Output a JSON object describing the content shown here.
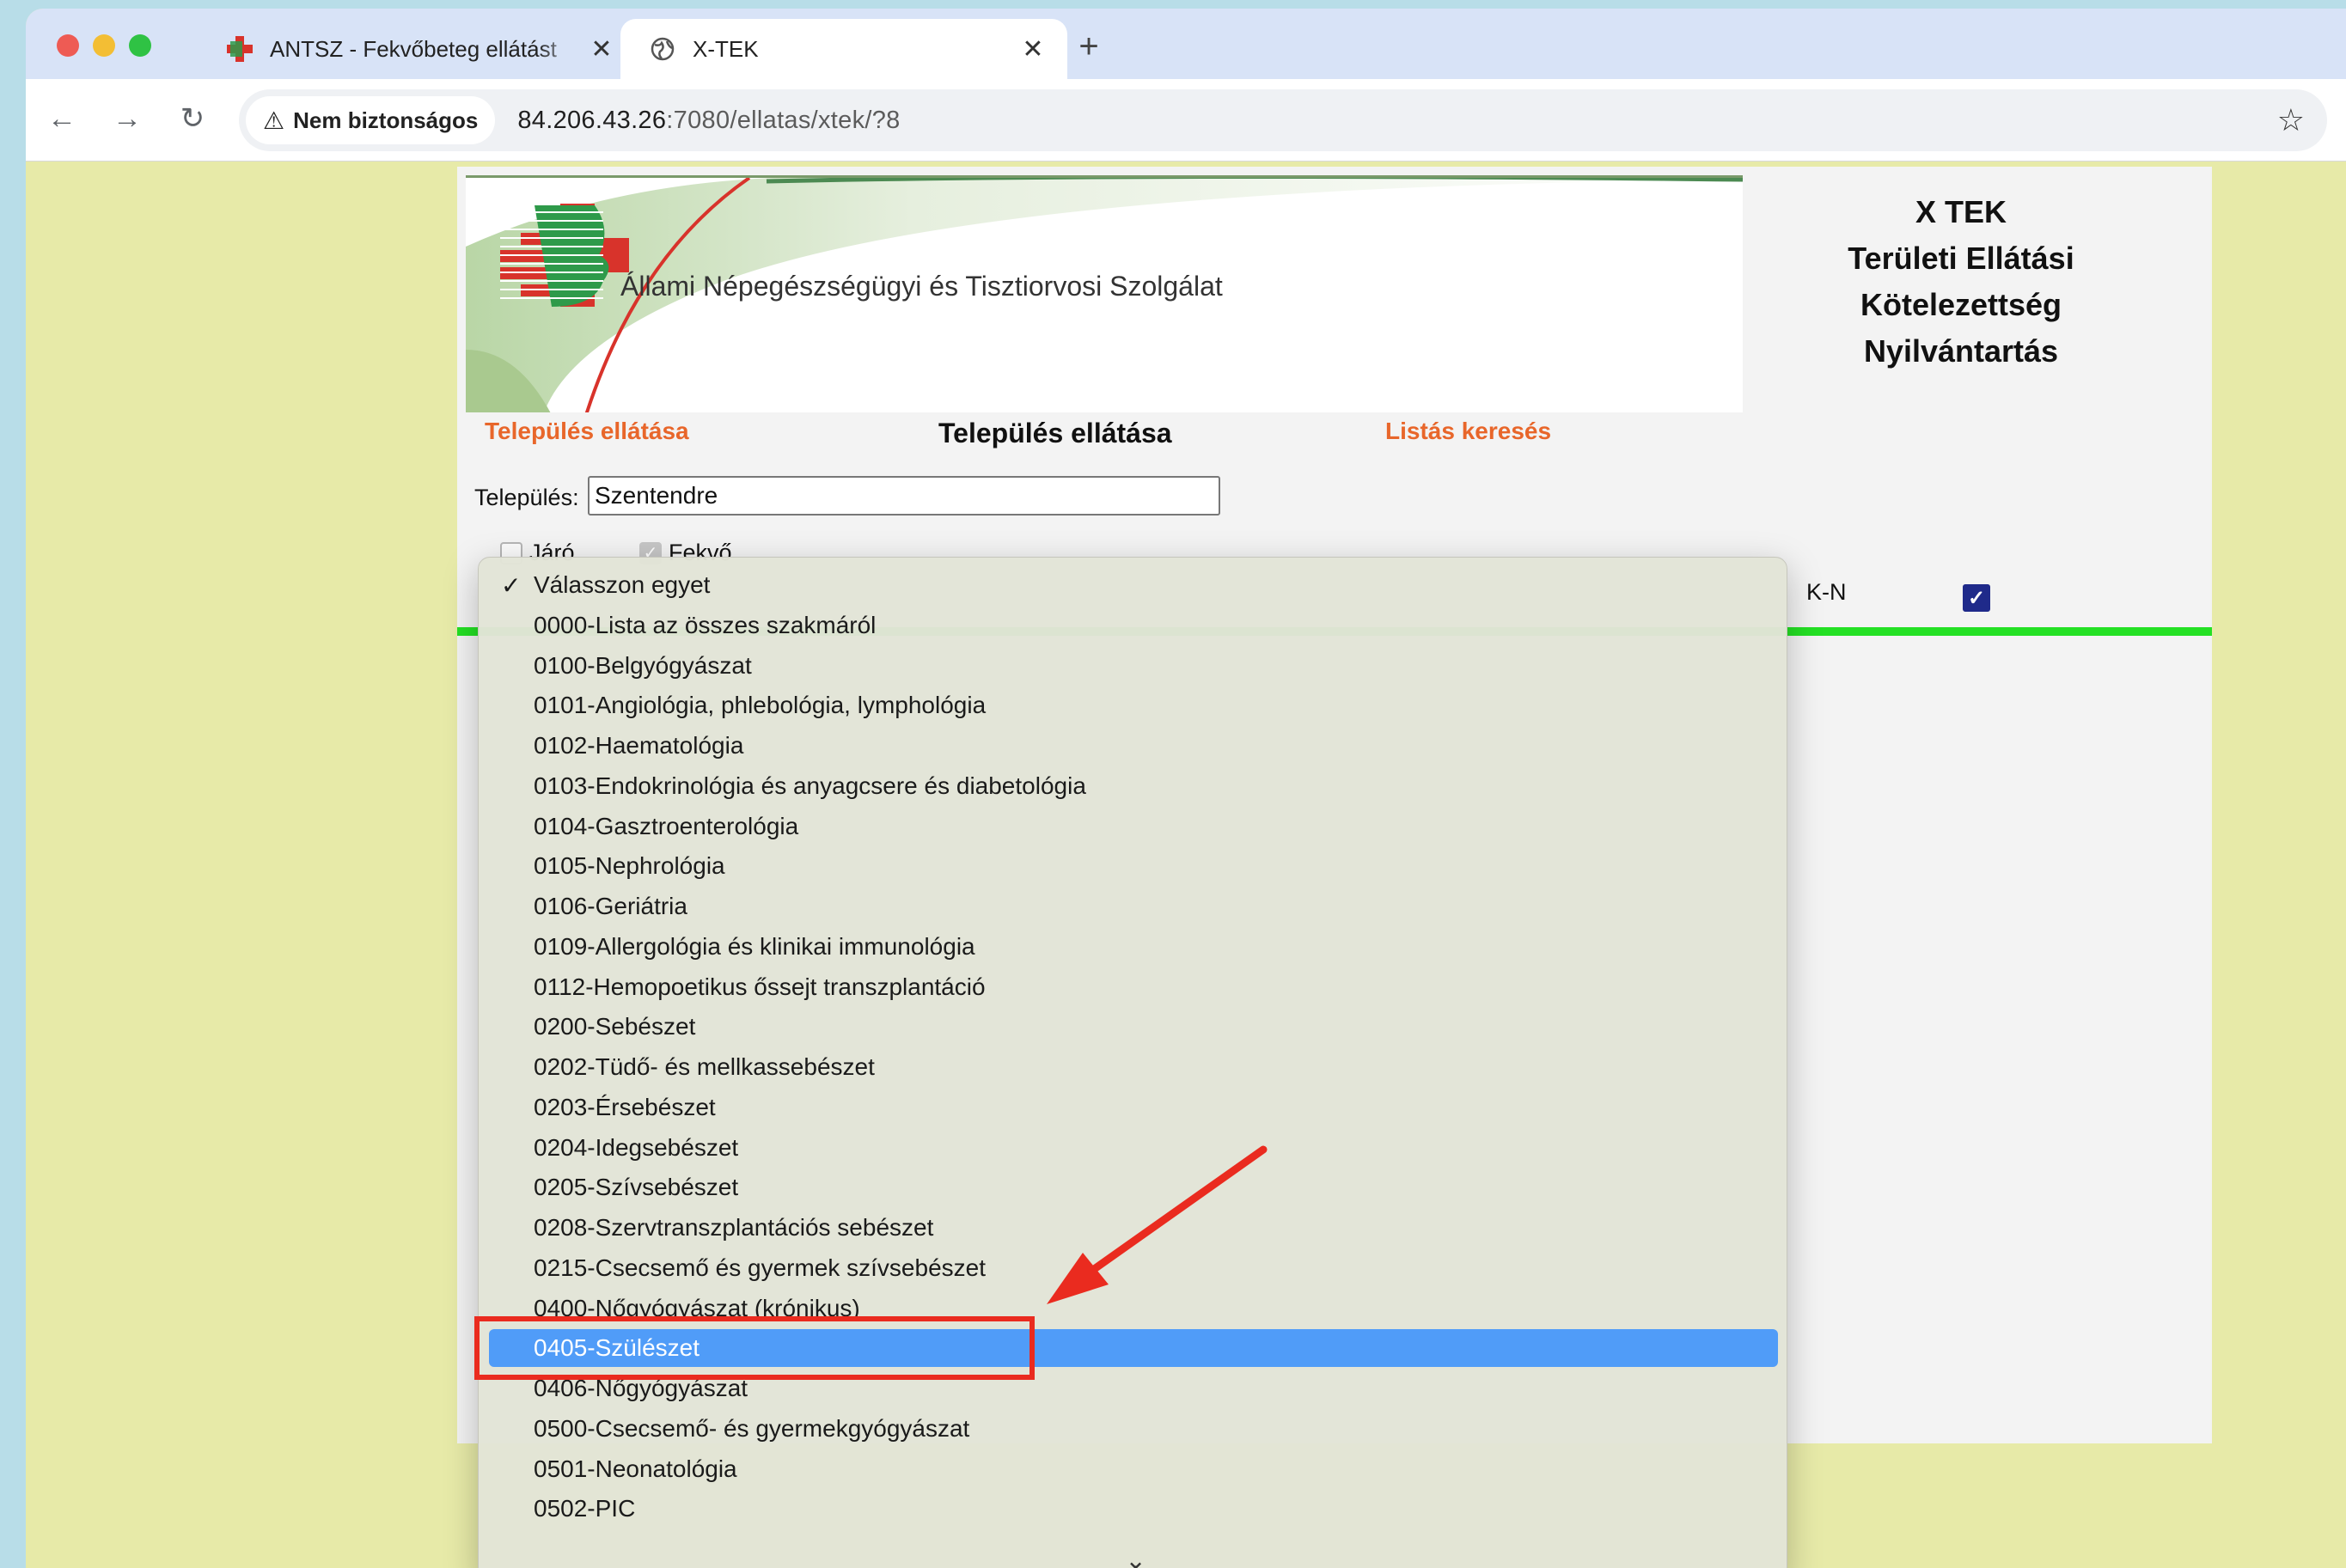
{
  "browser": {
    "tabs": [
      {
        "title": "ANTSZ - Fekvőbeteg ellátást",
        "icon": "antsz-cross-icon",
        "active": false
      },
      {
        "title": "X-TEK",
        "icon": "globe-icon",
        "active": true
      }
    ],
    "security_label": "Nem biztonságos",
    "url_host": "84.206.43.26",
    "url_path": ":7080/ellatas/xtek/?8"
  },
  "page": {
    "banner_title": "Állami Népegészségügyi és Tisztiorvosi Szolgálat",
    "side_title": [
      "X TEK",
      "Területi Ellátási",
      "Kötelezettség",
      "Nyilvántartás"
    ],
    "link_left": "Település ellátása",
    "center_heading": "Település ellátása",
    "link_right": "Listás keresés",
    "settlement_label": "Település:",
    "settlement_value": "Szentendre",
    "checkbox_jaro": {
      "label": "Járó",
      "checked": false
    },
    "checkbox_fekvo": {
      "label": "Fekvő",
      "checked": true
    },
    "kn_label": "K-N",
    "kn_checked": true
  },
  "dropdown": {
    "selected_index": 19,
    "options": [
      "Válasszon egyet",
      "0000-Lista az összes szakmáról",
      "0100-Belgyógyászat",
      "0101-Angiológia, phlebológia, lymphológia",
      "0102-Haematológia",
      "0103-Endokrinológia és anyagcsere és diabetológia",
      "0104-Gasztroenterológia",
      "0105-Nephrológia",
      "0106-Geriátria",
      "0109-Allergológia és klinikai immunológia",
      "0112-Hemopoetikus őssejt transzplantáció",
      "0200-Sebészet",
      "0202-Tüdő- és mellkassebészet",
      "0203-Érsebészet",
      "0204-Idegsebészet",
      "0205-Szívsebészet",
      "0208-Szervtranszplantációs sebészet",
      "0215-Csecsemő és gyermek szívsebészet",
      "0400-Nőgyógyászat (krónikus)",
      "0405-Szülészet",
      "0406-Nőgyógyászat",
      "0500-Csecsemő- és gyermekgyógyászat",
      "0501-Neonatológia",
      "0502-PIC"
    ],
    "checked_index": 0
  },
  "colors": {
    "link_orange": "#e8662a",
    "selection_blue": "#509cf8",
    "green_bar": "#24e024",
    "annotation_red": "#ea2b1f"
  }
}
